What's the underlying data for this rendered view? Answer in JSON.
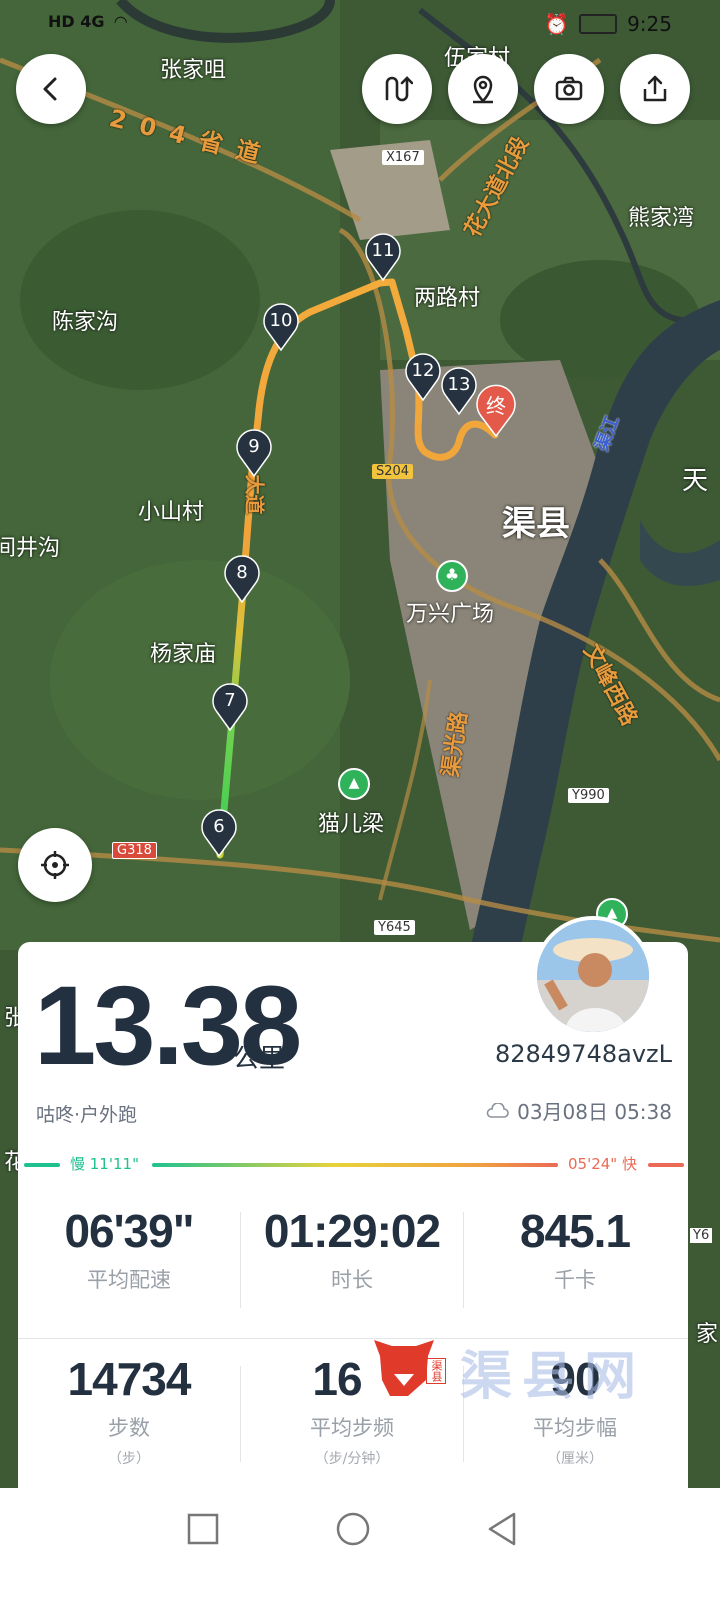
{
  "status_bar": {
    "network": "HD 4G",
    "time": "9:25"
  },
  "map_labels": {
    "zhangjiazui": "张家咀",
    "road_204": "204省道",
    "wujiacun": "伍家村",
    "x167": "X167",
    "avenue_north": "花大道北段",
    "xiongjiawan": "熊家湾",
    "chenjiagou": "陈家沟",
    "lianglucun": "两路村",
    "qujiang": "渠江",
    "s204": "S204",
    "xiaoshancun": "小山村",
    "qu_county": "渠县",
    "tian": "天",
    "jingou": "间井沟",
    "wanxing_square": "万兴广场",
    "yangjiamiao": "杨家庙",
    "wenfeng_west": "文峰西路",
    "quguang_road": "渠光路",
    "y990": "Y990",
    "g318": "G318",
    "maoerliang": "猫儿梁",
    "y645": "Y645",
    "zhang_edge": "张",
    "hua_edge": "花",
    "y6_edge": "Y6",
    "jia_edge": "家",
    "road_center": "大道"
  },
  "km_markers": [
    "6",
    "7",
    "8",
    "9",
    "10",
    "11",
    "12",
    "13"
  ],
  "end_marker": "终",
  "summary": {
    "distance": "13.38",
    "distance_unit": "公里",
    "user_id": "82849748avzL",
    "sport_type": "咕咚·户外跑",
    "datetime": "03月08日 05:38",
    "pace_slow": "慢 11'11\"",
    "pace_fast": "05'24\" 快"
  },
  "stats": {
    "avg_pace": {
      "value": "06'39\"",
      "label": "平均配速"
    },
    "duration": {
      "value": "01:29:02",
      "label": "时长"
    },
    "calories": {
      "value": "845.1",
      "label": "千卡"
    },
    "steps": {
      "value": "14734",
      "label": "步数",
      "sub": "（步）"
    },
    "cadence": {
      "value": "16",
      "label": "平均步频",
      "sub": "（步/分钟）"
    },
    "stride": {
      "value": "90",
      "label": "平均步幅",
      "sub": "（厘米）"
    }
  },
  "watermark": {
    "text": "渠县网",
    "seal": "渠县"
  },
  "colors": {
    "pace_slow": "#1fc28f",
    "pace_fast": "#ea6a55",
    "text_dark": "#23303f"
  }
}
